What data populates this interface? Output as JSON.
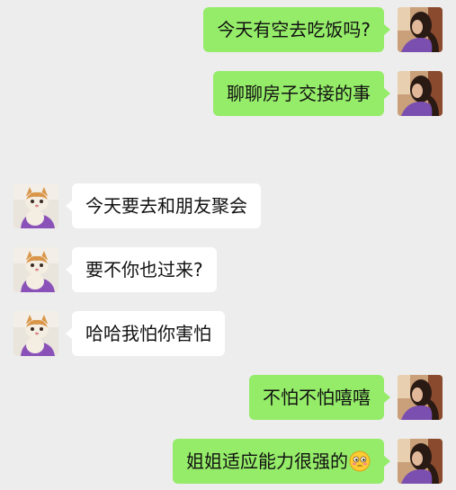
{
  "messages": [
    {
      "side": "out",
      "text": "今天有空去吃饭吗?"
    },
    {
      "side": "out",
      "text": "聊聊房子交接的事"
    },
    {
      "side": "in",
      "text": "今天要去和朋友聚会"
    },
    {
      "side": "in",
      "text": "要不你也过来?"
    },
    {
      "side": "in",
      "text": "哈哈我怕你害怕"
    },
    {
      "side": "out",
      "text": "不怕不怕嘻嘻"
    },
    {
      "side": "out",
      "text": "姐姐适应能力很强的",
      "emoji": "shy-flushed-face-emoji"
    }
  ],
  "colors": {
    "background": "#ededed",
    "outgoing_bubble": "#95ec69",
    "incoming_bubble": "#ffffff"
  }
}
